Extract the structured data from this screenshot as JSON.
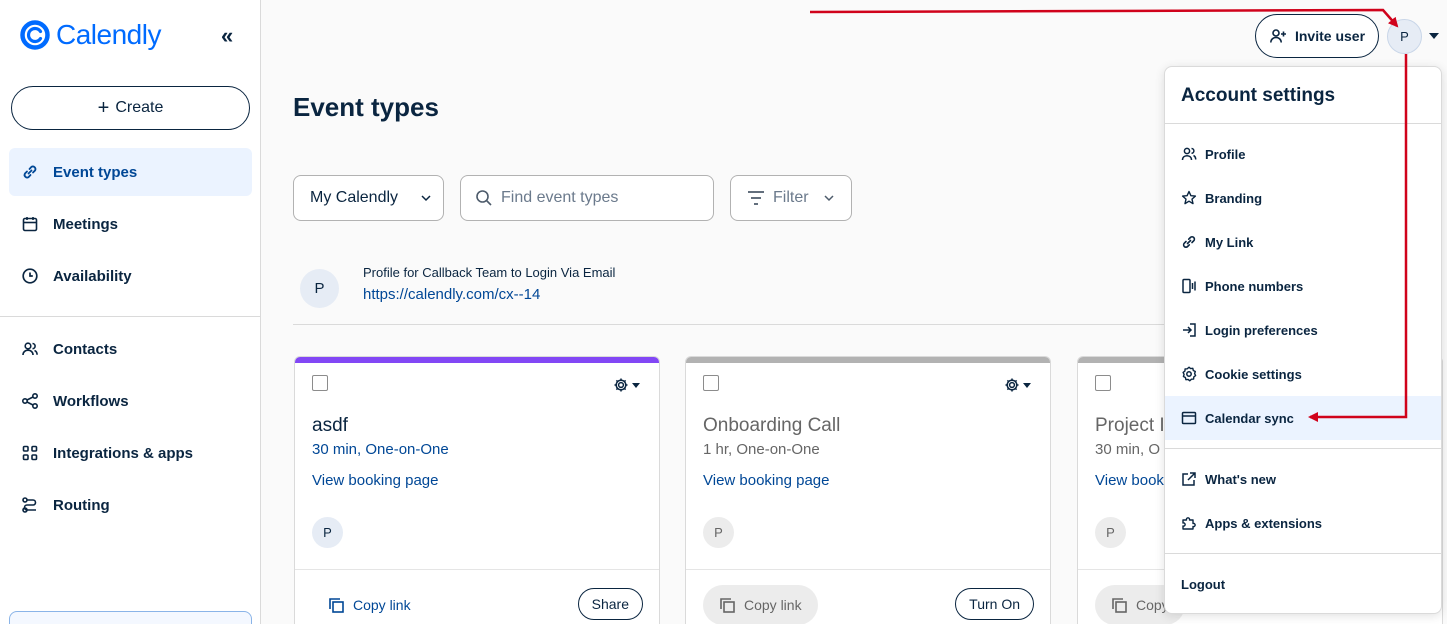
{
  "brand": {
    "name": "Calendly",
    "color": "#006bff"
  },
  "sidebar": {
    "collapse_icon": "double-chevron-left-icon",
    "create_label": "Create",
    "items": [
      {
        "label": "Event types",
        "icon": "link-icon",
        "active": true
      },
      {
        "label": "Meetings",
        "icon": "calendar-icon"
      },
      {
        "label": "Availability",
        "icon": "clock-icon"
      },
      {
        "label": "Contacts",
        "icon": "contacts-icon"
      },
      {
        "label": "Workflows",
        "icon": "workflow-icon"
      },
      {
        "label": "Integrations & apps",
        "icon": "apps-grid-icon"
      },
      {
        "label": "Routing",
        "icon": "routing-icon"
      }
    ]
  },
  "header": {
    "invite_label": "Invite user",
    "avatar_initial": "P"
  },
  "main": {
    "title": "Event types",
    "calendar_select": "My Calendly",
    "search_placeholder": "Find event types",
    "filter_label": "Filter",
    "profile": {
      "initial": "P",
      "name": "Profile for Callback Team to Login Via Email",
      "link": "https://calendly.com/cx--14"
    },
    "cards": [
      {
        "title": "asdf",
        "meta": "30 min, One-on-One",
        "view_label": "View booking page",
        "host_initial": "P",
        "copy_label": "Copy link",
        "action_label": "Share",
        "accent": "#8247f5",
        "enabled": true
      },
      {
        "title": "Onboarding Call",
        "meta": "1 hr, One-on-One",
        "view_label": "View booking page",
        "host_initial": "P",
        "copy_label": "Copy link",
        "action_label": "Turn On",
        "accent": "#b2b2b2",
        "enabled": false
      },
      {
        "title": "Project I",
        "meta": "30 min, O",
        "view_label": "View book",
        "host_initial": "P",
        "copy_label": "Copy",
        "action_label": "",
        "accent": "#b2b2b2",
        "enabled": false
      }
    ]
  },
  "account_menu": {
    "title": "Account settings",
    "items": [
      {
        "label": "Profile",
        "icon": "profile-icon"
      },
      {
        "label": "Branding",
        "icon": "star-icon"
      },
      {
        "label": "My Link",
        "icon": "link-icon"
      },
      {
        "label": "Phone numbers",
        "icon": "phone-icon"
      },
      {
        "label": "Login preferences",
        "icon": "login-icon"
      },
      {
        "label": "Cookie settings",
        "icon": "cookie-gear-icon"
      },
      {
        "label": "Calendar sync",
        "icon": "calendar-sync-icon",
        "highlighted": true
      }
    ],
    "secondary_items": [
      {
        "label": "What's new",
        "icon": "external-link-icon"
      },
      {
        "label": "Apps & extensions",
        "icon": "puzzle-icon"
      }
    ],
    "logout_label": "Logout"
  },
  "annotation_color": "#d0021b"
}
